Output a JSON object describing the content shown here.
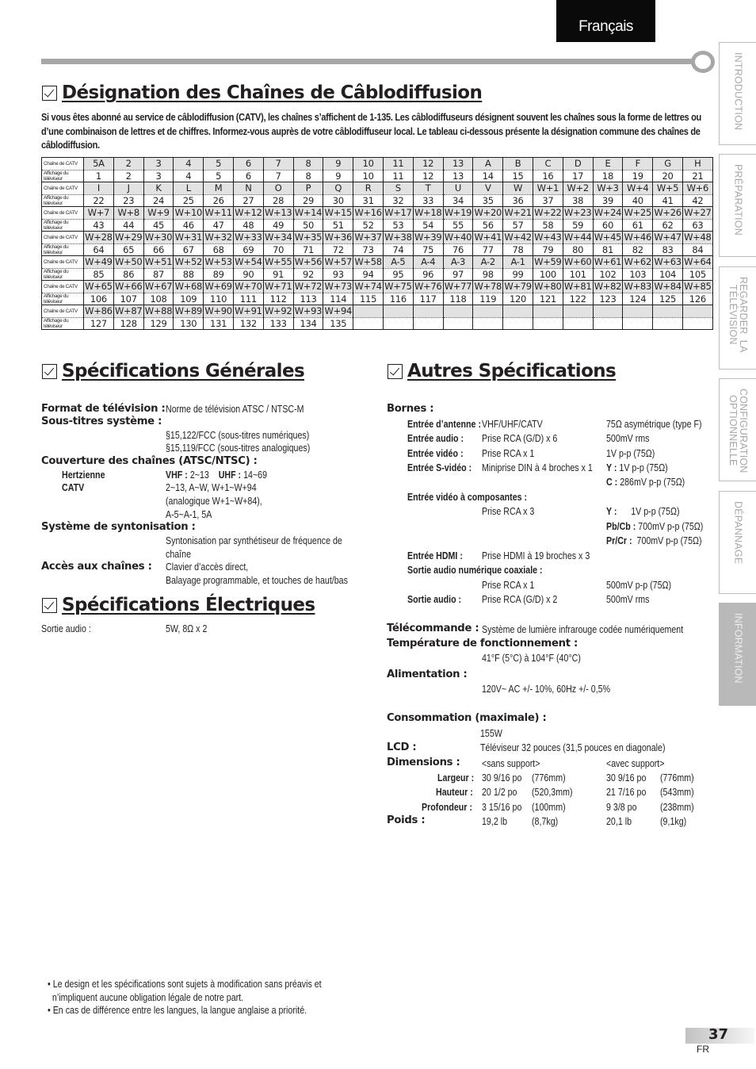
{
  "language_tab": "Français",
  "side_tabs": [
    {
      "label": "INTRODUCTION",
      "active": false
    },
    {
      "label": "PRÉPARATION",
      "active": false
    },
    {
      "label": "REGARDER  LA\nTÉLÉVISION",
      "active": false
    },
    {
      "label": "CONFIGURATION\nOPTIONNELLE",
      "active": false
    },
    {
      "label": "DÉPANNAGE",
      "active": false
    },
    {
      "label": "INFORMATION",
      "active": true
    }
  ],
  "cable_section": {
    "title": "Désignation des Chaînes de Câblodiffusion",
    "intro": "Si vous êtes abonné au service de câblodiffusion (CATV), les chaînes s’affichent de 1-135. Les câblodiffuseurs désignent souvent les chaînes sous la forme de lettres ou d’une combinaison de lettres et de chiffres. Informez-vous auprès de votre câblodiffuseur local. Le tableau ci-dessous présente la désignation commune des chaînes de câblodiffusion.",
    "row_label_catv": "Chaîne de CATV",
    "row_label_tv": "Affichage du téléviseur",
    "blocks": [
      {
        "catv": [
          "5A",
          "2",
          "3",
          "4",
          "5",
          "6",
          "7",
          "8",
          "9",
          "10",
          "11",
          "12",
          "13",
          "A",
          "B",
          "C",
          "D",
          "E",
          "F",
          "G",
          "H"
        ],
        "tv": [
          "1",
          "2",
          "3",
          "4",
          "5",
          "6",
          "7",
          "8",
          "9",
          "10",
          "11",
          "12",
          "13",
          "14",
          "15",
          "16",
          "17",
          "18",
          "19",
          "20",
          "21"
        ]
      },
      {
        "catv": [
          "I",
          "J",
          "K",
          "L",
          "M",
          "N",
          "O",
          "P",
          "Q",
          "R",
          "S",
          "T",
          "U",
          "V",
          "W",
          "W+1",
          "W+2",
          "W+3",
          "W+4",
          "W+5",
          "W+6"
        ],
        "tv": [
          "22",
          "23",
          "24",
          "25",
          "26",
          "27",
          "28",
          "29",
          "30",
          "31",
          "32",
          "33",
          "34",
          "35",
          "36",
          "37",
          "38",
          "39",
          "40",
          "41",
          "42"
        ]
      },
      {
        "catv": [
          "W+7",
          "W+8",
          "W+9",
          "W+10",
          "W+11",
          "W+12",
          "W+13",
          "W+14",
          "W+15",
          "W+16",
          "W+17",
          "W+18",
          "W+19",
          "W+20",
          "W+21",
          "W+22",
          "W+23",
          "W+24",
          "W+25",
          "W+26",
          "W+27"
        ],
        "tv": [
          "43",
          "44",
          "45",
          "46",
          "47",
          "48",
          "49",
          "50",
          "51",
          "52",
          "53",
          "54",
          "55",
          "56",
          "57",
          "58",
          "59",
          "60",
          "61",
          "62",
          "63"
        ]
      },
      {
        "catv": [
          "W+28",
          "W+29",
          "W+30",
          "W+31",
          "W+32",
          "W+33",
          "W+34",
          "W+35",
          "W+36",
          "W+37",
          "W+38",
          "W+39",
          "W+40",
          "W+41",
          "W+42",
          "W+43",
          "W+44",
          "W+45",
          "W+46",
          "W+47",
          "W+48"
        ],
        "tv": [
          "64",
          "65",
          "66",
          "67",
          "68",
          "69",
          "70",
          "71",
          "72",
          "73",
          "74",
          "75",
          "76",
          "77",
          "78",
          "79",
          "80",
          "81",
          "82",
          "83",
          "84"
        ]
      },
      {
        "catv": [
          "W+49",
          "W+50",
          "W+51",
          "W+52",
          "W+53",
          "W+54",
          "W+55",
          "W+56",
          "W+57",
          "W+58",
          "A-5",
          "A-4",
          "A-3",
          "A-2",
          "A-1",
          "W+59",
          "W+60",
          "W+61",
          "W+62",
          "W+63",
          "W+64"
        ],
        "tv": [
          "85",
          "86",
          "87",
          "88",
          "89",
          "90",
          "91",
          "92",
          "93",
          "94",
          "95",
          "96",
          "97",
          "98",
          "99",
          "100",
          "101",
          "102",
          "103",
          "104",
          "105"
        ]
      },
      {
        "catv": [
          "W+65",
          "W+66",
          "W+67",
          "W+68",
          "W+69",
          "W+70",
          "W+71",
          "W+72",
          "W+73",
          "W+74",
          "W+75",
          "W+76",
          "W+77",
          "W+78",
          "W+79",
          "W+80",
          "W+81",
          "W+82",
          "W+83",
          "W+84",
          "W+85"
        ],
        "tv": [
          "106",
          "107",
          "108",
          "109",
          "110",
          "111",
          "112",
          "113",
          "114",
          "115",
          "116",
          "117",
          "118",
          "119",
          "120",
          "121",
          "122",
          "123",
          "124",
          "125",
          "126"
        ]
      },
      {
        "catv": [
          "W+86",
          "W+87",
          "W+88",
          "W+89",
          "W+90",
          "W+91",
          "W+92",
          "W+93",
          "W+94",
          "",
          "",
          "",
          "",
          "",
          "",
          "",
          "",
          "",
          "",
          "",
          ""
        ],
        "tv": [
          "127",
          "128",
          "129",
          "130",
          "131",
          "132",
          "133",
          "134",
          "135",
          "",
          "",
          "",
          "",
          "",
          "",
          "",
          "",
          "",
          "",
          "",
          ""
        ]
      }
    ]
  },
  "general": {
    "title": "Spécifications Générales",
    "tv_format_label": "Format de télévision :",
    "tv_format_value": "Norme de télévision ATSC / NTSC-M",
    "captions_label": "Sous-titres système :",
    "captions_1": "§15,122/FCC (sous-titres numériques)",
    "captions_2": "§15,119/FCC (sous-titres analogiques)",
    "coverage_label": "Couverture des chaînes (ATSC/NTSC) :",
    "terrestrial_label": "Hertzienne",
    "vhf_label": "VHF :",
    "vhf_value": "2~13",
    "uhf_label": "UHF :",
    "uhf_value": "14~69",
    "catv_label": "CATV",
    "catv_1": "2~13, A~W, W+1~W+94",
    "catv_2": "(analogique W+1~W+84),",
    "catv_3": "A-5~A-1, 5A",
    "tuning_label": "Système de syntonisation :",
    "tuning_1": "Syntonisation par synthétiseur de fréquence de",
    "tuning_2": "chaîne",
    "access_label": "Accès aux chaînes :",
    "access_1": "Clavier d’accès direct,",
    "access_2": "Balayage programmable, et touches de haut/bas"
  },
  "electrical": {
    "title": "Spécifications Électriques",
    "audio_out_label": "Sortie audio :",
    "audio_out_value": "5W, 8Ω x 2"
  },
  "other": {
    "title": "Autres Spécifications",
    "terminals_label": "Bornes :",
    "antenna_label": "Entrée d’antenne :",
    "antenna_value": "VHF/UHF/CATV",
    "antenna_spec": "75Ω asymétrique (type F)",
    "audio_in_label": "Entrée audio :",
    "audio_in_value": "Prise RCA (G/D) x 6",
    "audio_in_spec": "500mV rms",
    "video_in_label": "Entrée vidéo :",
    "video_in_value": "Prise RCA x 1",
    "video_in_spec": "1V p-p (75Ω)",
    "svideo_label": "Entrée S-vidéo :",
    "svideo_value": "Miniprise DIN à 4 broches x 1",
    "svideo_y_label": "Y :",
    "svideo_y_spec": "1V p-p (75Ω)",
    "svideo_c_label": "C :",
    "svideo_c_spec": "286mV p-p (75Ω)",
    "component_label": "Entrée vidéo à composantes :",
    "component_value": "Prise RCA x 3",
    "comp_y_label": "Y :",
    "comp_y_spec": "1V p-p (75Ω)",
    "comp_pb_label": "Pb/Cb :",
    "comp_pb_spec": "700mV p-p (75Ω)",
    "comp_pr_label": "Pr/Cr :",
    "comp_pr_spec": "700mV p-p (75Ω)",
    "hdmi_label": "Entrée HDMI :",
    "hdmi_value": "Prise HDMI à 19 broches x 3",
    "coax_label": "Sortie audio numérique coaxiale :",
    "coax_value": "Prise RCA x 1",
    "coax_spec": "500mV p-p (75Ω)",
    "audio_out_label": "Sortie audio :",
    "audio_out_value": "Prise RCA (G/D) x 2",
    "audio_out_spec": "500mV rms",
    "remote_label": "Télécommande :",
    "remote_value": "Système de lumière infrarouge codée numériquement",
    "temp_label": "Température de fonctionnement :",
    "temp_value": "41°F (5°C) à 104°F (40°C)",
    "power_label": "Alimentation :",
    "power_value": "120V~ AC +/- 10%, 60Hz +/- 0,5%",
    "consumption_label": "Consommation (maximale) :",
    "consumption_value": "155W",
    "lcd_label": "LCD :",
    "lcd_value": "Téléviseur 32 pouces (31,5 pouces en diagonale)",
    "dimensions_label": "Dimensions :",
    "without_stand": "<sans support>",
    "with_stand": "<avec support>",
    "width_label": "Largeur :",
    "width_ws_in": "30 9/16 po",
    "width_ws_mm": "(776mm)",
    "width_s_in": "30 9/16  po",
    "width_s_mm": "(776mm)",
    "height_label": "Hauteur :",
    "height_ws_in": "20 1/2 po",
    "height_ws_mm": "(520,3mm)",
    "height_s_in": "21 7/16 po",
    "height_s_mm": "(543mm)",
    "depth_label": "Profondeur :",
    "depth_ws_in": "3 15/16 po",
    "depth_ws_mm": "(100mm)",
    "depth_s_in": "9 3/8 po",
    "depth_s_mm": "(238mm)",
    "weight_label": "Poids :",
    "weight_ws_lb": "19,2 lb",
    "weight_ws_kg": "(8,7kg)",
    "weight_s_lb": "20,1 lb",
    "weight_s_kg": "(9,1kg)"
  },
  "notes": [
    "• Le design et les spécifications sont sujets à modification sans préavis et",
    "  n’impliquent aucune obligation légale de notre part.",
    "• En cas de différence entre les langues, la langue anglaise a priorité."
  ],
  "page_number": "37",
  "page_lang": "FR"
}
